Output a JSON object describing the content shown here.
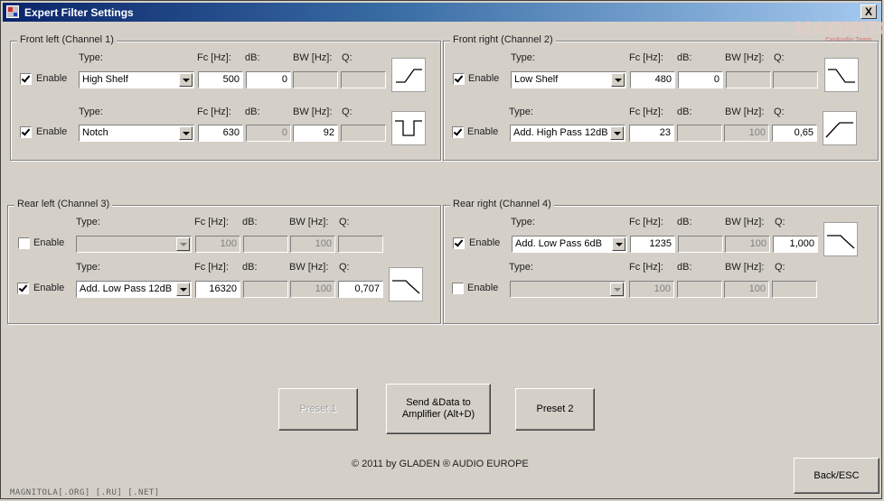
{
  "window": {
    "title": "Expert Filter Settings",
    "close_label": "X",
    "watermark_logo": "MAGNITOLA",
    "watermark_sub": "CarAudio Team"
  },
  "labels": {
    "type": "Type:",
    "fc": "Fc [Hz]:",
    "db": "dB:",
    "bw": "BW [Hz]:",
    "q": "Q:",
    "enable": "Enable"
  },
  "groups": {
    "front_left": {
      "title": "Front left (Channel 1)",
      "rows": [
        {
          "enabled": true,
          "type": "High Shelf",
          "fc": "500",
          "db": "0",
          "bw": "",
          "q": "",
          "shape": "high-shelf"
        },
        {
          "enabled": true,
          "type": "Notch",
          "fc": "630",
          "db": "0",
          "bw": "92",
          "q": "",
          "shape": "notch"
        }
      ]
    },
    "front_right": {
      "title": "Front right (Channel 2)",
      "rows": [
        {
          "enabled": true,
          "type": "Low Shelf",
          "fc": "480",
          "db": "0",
          "bw": "",
          "q": "",
          "shape": "low-shelf"
        },
        {
          "enabled": true,
          "type": "Add. High Pass 12dB",
          "fc": "23",
          "db": "",
          "bw": "100",
          "q": "0,65",
          "shape": "high-pass"
        }
      ]
    },
    "rear_left": {
      "title": "Rear left (Channel 3)",
      "rows": [
        {
          "enabled": false,
          "type": "",
          "fc": "100",
          "db": "",
          "bw": "100",
          "q": "",
          "shape": ""
        },
        {
          "enabled": true,
          "type": "Add. Low Pass 12dB",
          "fc": "16320",
          "db": "",
          "bw": "100",
          "q": "0,707",
          "shape": "low-pass"
        }
      ]
    },
    "rear_right": {
      "title": "Rear right (Channel 4)",
      "rows": [
        {
          "enabled": true,
          "type": "Add. Low Pass 6dB",
          "fc": "1235",
          "db": "",
          "bw": "100",
          "q": "1,000",
          "shape": "low-pass"
        },
        {
          "enabled": false,
          "type": "",
          "fc": "100",
          "db": "",
          "bw": "100",
          "q": "",
          "shape": ""
        }
      ]
    }
  },
  "buttons": {
    "preset1": "Preset 1",
    "send": "Send &Data to Amplifier (Alt+D)",
    "preset2": "Preset 2",
    "back": "Back/ESC"
  },
  "copyright": "© 2011 by GLADEN ® AUDIO EUROPE",
  "footer_watermark": "MAGNITOLA[.ORG] [.RU] [.NET]"
}
